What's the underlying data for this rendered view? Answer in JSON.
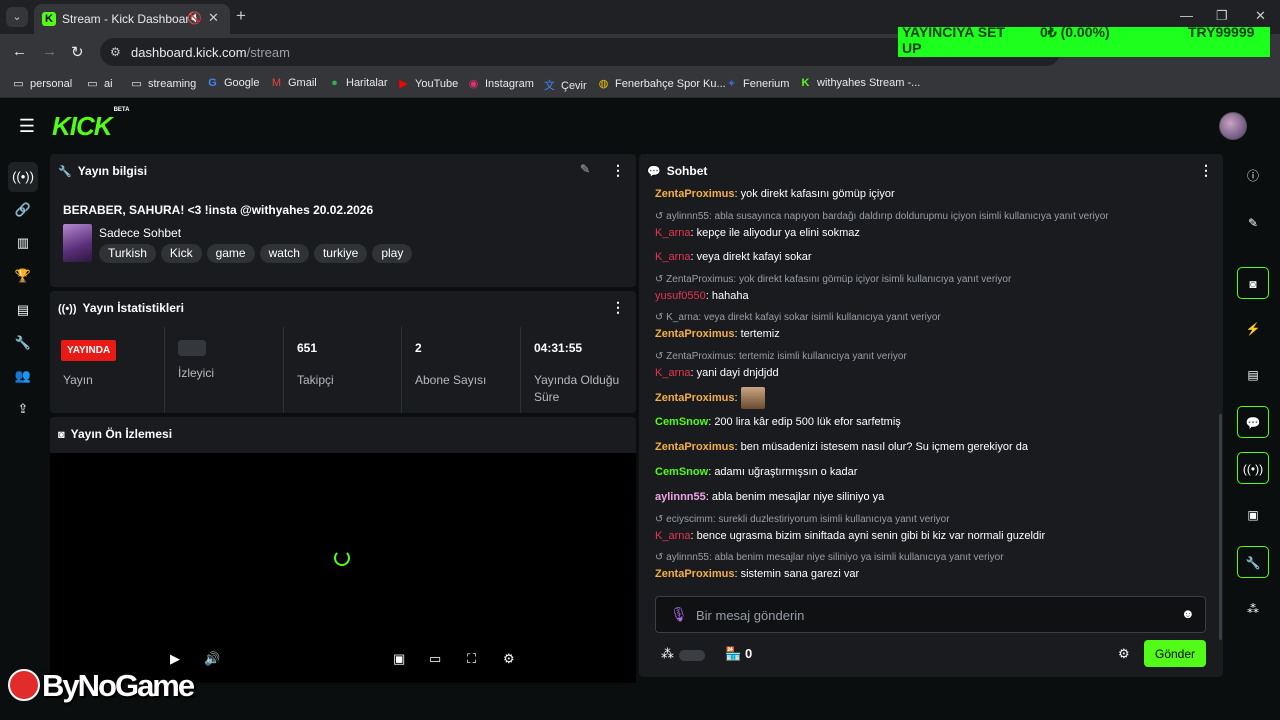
{
  "browser": {
    "tab_title": "Stream - Kick Dashboard",
    "url_host": "dashboard.kick.com",
    "url_path": "/stream",
    "ticker": [
      "YAYINCIYA SET UP",
      "0₺ (0.00%)",
      "TRY99999"
    ],
    "bookmarks": [
      {
        "icon": "folder-icon",
        "label": "personal"
      },
      {
        "icon": "folder-icon",
        "label": "ai"
      },
      {
        "icon": "folder-icon",
        "label": "streaming"
      },
      {
        "icon": "google-icon",
        "label": "Google"
      },
      {
        "icon": "gmail-icon",
        "label": "Gmail"
      },
      {
        "icon": "maps-icon",
        "label": "Haritalar"
      },
      {
        "icon": "youtube-icon",
        "label": "YouTube"
      },
      {
        "icon": "instagram-icon",
        "label": "Instagram"
      },
      {
        "icon": "translate-icon",
        "label": "Çevir"
      },
      {
        "icon": "fenerbahce-icon",
        "label": "Fenerbahçe Spor Ku..."
      },
      {
        "icon": "fenerium-icon",
        "label": "Fenerium"
      },
      {
        "icon": "kick-icon",
        "label": "withyahes Stream -..."
      }
    ]
  },
  "app": {
    "logo": "KICK",
    "logo_badge": "BETA",
    "accent": "#53fc18"
  },
  "stream_info": {
    "title": "Yayın bilgisi",
    "stream_title": "BERABER, SAHURA! <3 !insta @withyahes 20.02.2026",
    "category": "Sadece Sohbet",
    "tags": [
      "Turkish",
      "Kick",
      "game",
      "watch",
      "turkiye",
      "play"
    ]
  },
  "stats": {
    "title": "Yayın İstatistikleri",
    "live_badge": "YAYINDA",
    "items": [
      {
        "value": "",
        "label": "Yayın"
      },
      {
        "value": "",
        "label": "İzleyici"
      },
      {
        "value": "651",
        "label": "Takipçi"
      },
      {
        "value": "2",
        "label": "Abone Sayısı"
      },
      {
        "value": "04:31:55",
        "label": "Yayında Olduğu Süre"
      }
    ]
  },
  "preview": {
    "title": "Yayın Ön İzlemesi"
  },
  "chat": {
    "title": "Sohbet",
    "messages": [
      {
        "user": "ZentaProximus",
        "text": "yok direkt kafasını gömüp içiyor"
      },
      {
        "reply": "aylinnn55: abla susayınca napıyon bardağı daldırıp doldurupmu içiyon isimli kullanıcıya yanıt veriyor",
        "user": "K_arna",
        "text": "kepçe ile aliyodur ya elini sokmaz"
      },
      {
        "user": "K_arna",
        "text": "veya direkt kafayi sokar"
      },
      {
        "reply": "ZentaProximus: yok direkt kafasını gömüp içiyor isimli kullanıcıya yanıt veriyor",
        "user": "yusuf0550",
        "text": "hahaha"
      },
      {
        "reply": "K_arna: veya direkt kafayi sokar isimli kullanıcıya yanıt veriyor",
        "user": "ZentaProximus",
        "text": "tertemiz"
      },
      {
        "reply": "ZentaProximus: tertemiz isimli kullanıcıya yanıt veriyor",
        "user": "K_arna",
        "text": "yani dayi dnjdjdd"
      },
      {
        "user": "ZentaProximus",
        "text": ""
      },
      {
        "user": "CemSnow",
        "text": "200 lira kâr edip 500 lük efor sarfetmiş"
      },
      {
        "user": "ZentaProximus",
        "text": "ben müsadenizi istesem nasıl olur? Su içmem gerekiyor da"
      },
      {
        "user": "CemSnow",
        "text": "adamı uğraştırmışsın o kadar"
      },
      {
        "user": "aylinnn55",
        "text": "abla benim mesajlar niye siliniyo ya"
      },
      {
        "reply": "eciyscimm: surekli duzlestiriyorum isimli kullanıcıya yanıt veriyor",
        "user": "K_arna",
        "text": "bence ugrasma bizim siniftada ayni senin gibi bi kiz var normali guzeldir"
      },
      {
        "reply": "aylinnn55: abla benim mesajlar niye siliniyo ya isimli kullanıcıya yanıt veriyor",
        "user": "ZentaProximus",
        "text": "sistemin sana garezi var"
      }
    ],
    "input_placeholder": "Bir mesaj gönderin",
    "points": "0",
    "send_label": "Gönder"
  },
  "watermark": "ByNoGame"
}
